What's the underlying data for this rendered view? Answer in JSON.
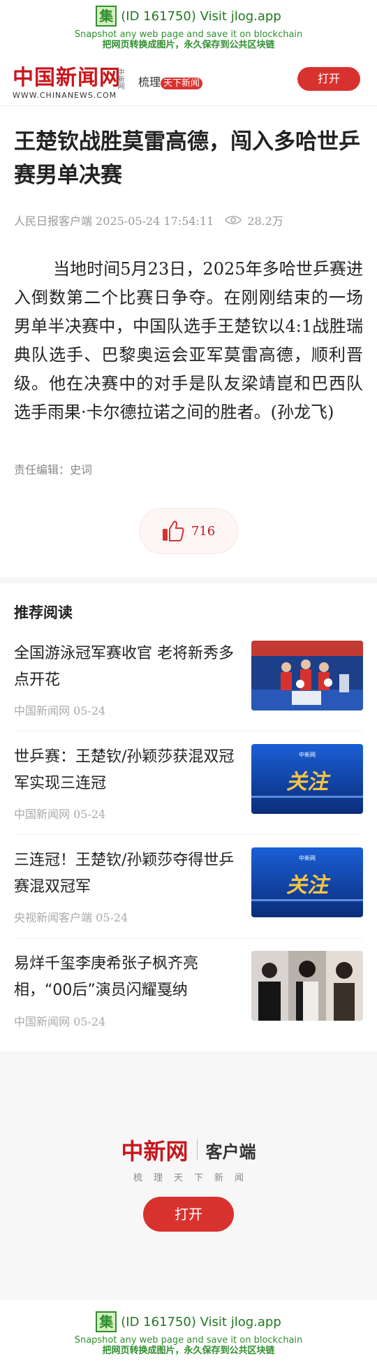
{
  "jlog": {
    "icon_char": "集",
    "id_text": "(ID 161750) Visit jlog.app",
    "line2": "Snapshot any web page and save it on blockchain",
    "line3": "把网页转换成图片，永久保存到公共区块链"
  },
  "header": {
    "logo_cn": "中国新闻网",
    "logo_side": "中新网",
    "logo_url": "WWW.CHINANEWS.COM",
    "slogan_prefix": "梳理",
    "slogan_badge": "天下新闻",
    "open_label": "打开"
  },
  "article": {
    "title": "王楚钦战胜莫雷高德，闯入多哈世乒赛男单决赛",
    "source": "人民日报客户端 2025-05-24 17:54:11",
    "views": "28.2万",
    "body": "当地时间5月23日，2025年多哈世乒赛进入倒数第二个比赛日争夺。在刚刚结束的一场男单半决赛中，中国队选手王楚钦以4:1战胜瑞典队选手、巴黎奥运会亚军莫雷高德，顺利晋级。他在决赛中的对手是队友梁靖崑和巴西队选手雨果·卡尔德拉诺之间的胜者。(孙龙飞)",
    "editor": "责任编辑：史词",
    "likes": "716"
  },
  "recommend": {
    "heading": "推荐阅读",
    "items": [
      {
        "headline": "全国游泳冠军赛收官 老将新秀多点开花",
        "source": "中国新闻网 05-24",
        "thumb": "podium-photo"
      },
      {
        "headline": "世乒赛：王楚钦/孙颖莎获混双冠军实现三连冠",
        "source": "中国新闻网 05-24",
        "thumb": "guanzhu-card"
      },
      {
        "headline": "三连冠！王楚钦/孙颖莎夺得世乒赛混双冠军",
        "source": "央视新闻客户端 05-24",
        "thumb": "guanzhu-card"
      },
      {
        "headline": "易烊千玺李庚希张子枫齐亮相，“00后”演员闪耀戛纳",
        "source": "中国新闻网 05-24",
        "thumb": "people-photo"
      }
    ],
    "card_label": "关注",
    "card_logo": "中新网"
  },
  "promo": {
    "logo_cn": "中新网",
    "app_label": "客户端",
    "sub": "梳理天下新闻",
    "open_label": "打开"
  },
  "colors": {
    "brand_red": "#c8161d",
    "button_red": "#d8322f",
    "jlog_green": "#2f8f2f"
  }
}
